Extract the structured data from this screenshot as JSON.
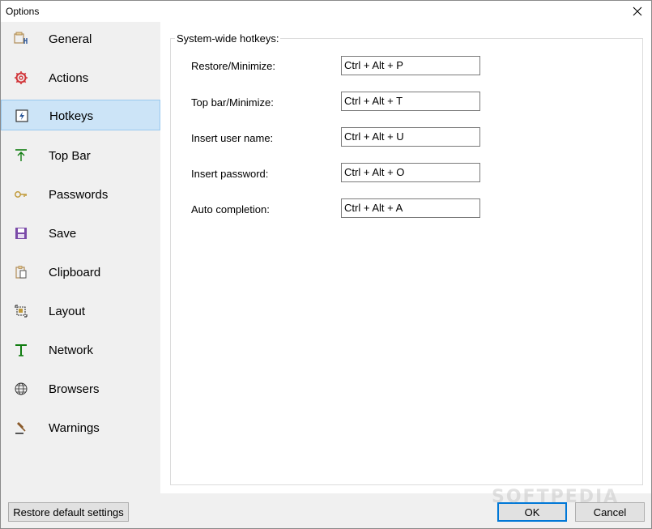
{
  "window": {
    "title": "Options"
  },
  "sidebar": {
    "items": [
      {
        "label": "General",
        "icon": "general-icon",
        "selected": false
      },
      {
        "label": "Actions",
        "icon": "gear-icon",
        "selected": false
      },
      {
        "label": "Hotkeys",
        "icon": "hotkey-icon",
        "selected": true
      },
      {
        "label": "Top Bar",
        "icon": "top-bar-icon",
        "selected": false
      },
      {
        "label": "Passwords",
        "icon": "key-icon",
        "selected": false
      },
      {
        "label": "Save",
        "icon": "floppy-disk-icon",
        "selected": false
      },
      {
        "label": "Clipboard",
        "icon": "clipboard-icon",
        "selected": false
      },
      {
        "label": "Layout",
        "icon": "layout-icon",
        "selected": false
      },
      {
        "label": "Network",
        "icon": "network-icon",
        "selected": false
      },
      {
        "label": "Browsers",
        "icon": "globe-icon",
        "selected": false
      },
      {
        "label": "Warnings",
        "icon": "gavel-icon",
        "selected": false
      }
    ]
  },
  "hotkeys": {
    "group_title": "System-wide hotkeys:",
    "rows": [
      {
        "label": "Restore/Minimize:",
        "value": "Ctrl + Alt + P"
      },
      {
        "label": "Top bar/Minimize:",
        "value": "Ctrl + Alt + T"
      },
      {
        "label": "Insert user name:",
        "value": "Ctrl + Alt + U"
      },
      {
        "label": "Insert password:",
        "value": "Ctrl + Alt + O"
      },
      {
        "label": "Auto completion:",
        "value": "Ctrl + Alt + A"
      }
    ]
  },
  "footer": {
    "restore_label": "Restore default settings",
    "ok_label": "OK",
    "cancel_label": "Cancel"
  },
  "watermark": "SOFTPEDIA",
  "colors": {
    "selection_bg": "#cce4f7",
    "accent": "#0078d7",
    "gear": "#d13438",
    "save": "#7a4aa8",
    "network": "#107c10"
  }
}
